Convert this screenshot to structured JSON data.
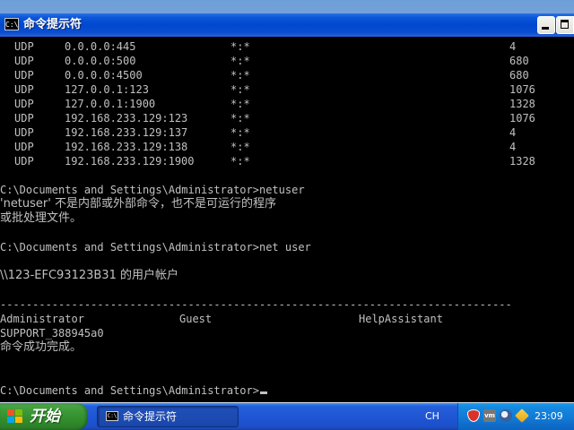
{
  "window": {
    "title": "命令提示符",
    "icon_glyph": "C:\\"
  },
  "console": {
    "udp_rows": [
      {
        "proto": "UDP",
        "local": "0.0.0.0:445",
        "foreign": "*:*",
        "pid": "4"
      },
      {
        "proto": "UDP",
        "local": "0.0.0.0:500",
        "foreign": "*:*",
        "pid": "680"
      },
      {
        "proto": "UDP",
        "local": "0.0.0.0:4500",
        "foreign": "*:*",
        "pid": "680"
      },
      {
        "proto": "UDP",
        "local": "127.0.0.1:123",
        "foreign": "*:*",
        "pid": "1076"
      },
      {
        "proto": "UDP",
        "local": "127.0.0.1:1900",
        "foreign": "*:*",
        "pid": "1328"
      },
      {
        "proto": "UDP",
        "local": "192.168.233.129:123",
        "foreign": "*:*",
        "pid": "1076"
      },
      {
        "proto": "UDP",
        "local": "192.168.233.129:137",
        "foreign": "*:*",
        "pid": "4"
      },
      {
        "proto": "UDP",
        "local": "192.168.233.129:138",
        "foreign": "*:*",
        "pid": "4"
      },
      {
        "proto": "UDP",
        "local": "192.168.233.129:1900",
        "foreign": "*:*",
        "pid": "1328"
      }
    ],
    "prompt1": "C:\\Documents and Settings\\Administrator>netuser",
    "error_line1": "'netuser' 不是内部或外部命令，也不是可运行的程序",
    "error_line2": "或批处理文件。",
    "prompt2": "C:\\Documents and Settings\\Administrator>net user",
    "accounts_header": "\\\\123-EFC93123B31 的用户帐户",
    "separator": "-------------------------------------------------------------------------------",
    "users_row1": [
      "Administrator",
      "Guest",
      "HelpAssistant"
    ],
    "users_row2": [
      "SUPPORT_388945a0"
    ],
    "success_line": "命令成功完成。",
    "prompt3": "C:\\Documents and Settings\\Administrator>"
  },
  "taskbar": {
    "start_label": "开始",
    "task_label": "命令提示符",
    "task_icon_glyph": "C:\\",
    "language": "CH",
    "vm_icon_text": "vm",
    "clock": "23:09"
  },
  "colors": {
    "console_bg": "#000000",
    "console_text": "#c0c0c0",
    "titlebar": "#0047cf",
    "taskbar": "#245edb",
    "start_button": "#3c9a36",
    "tray": "#1078d4"
  }
}
